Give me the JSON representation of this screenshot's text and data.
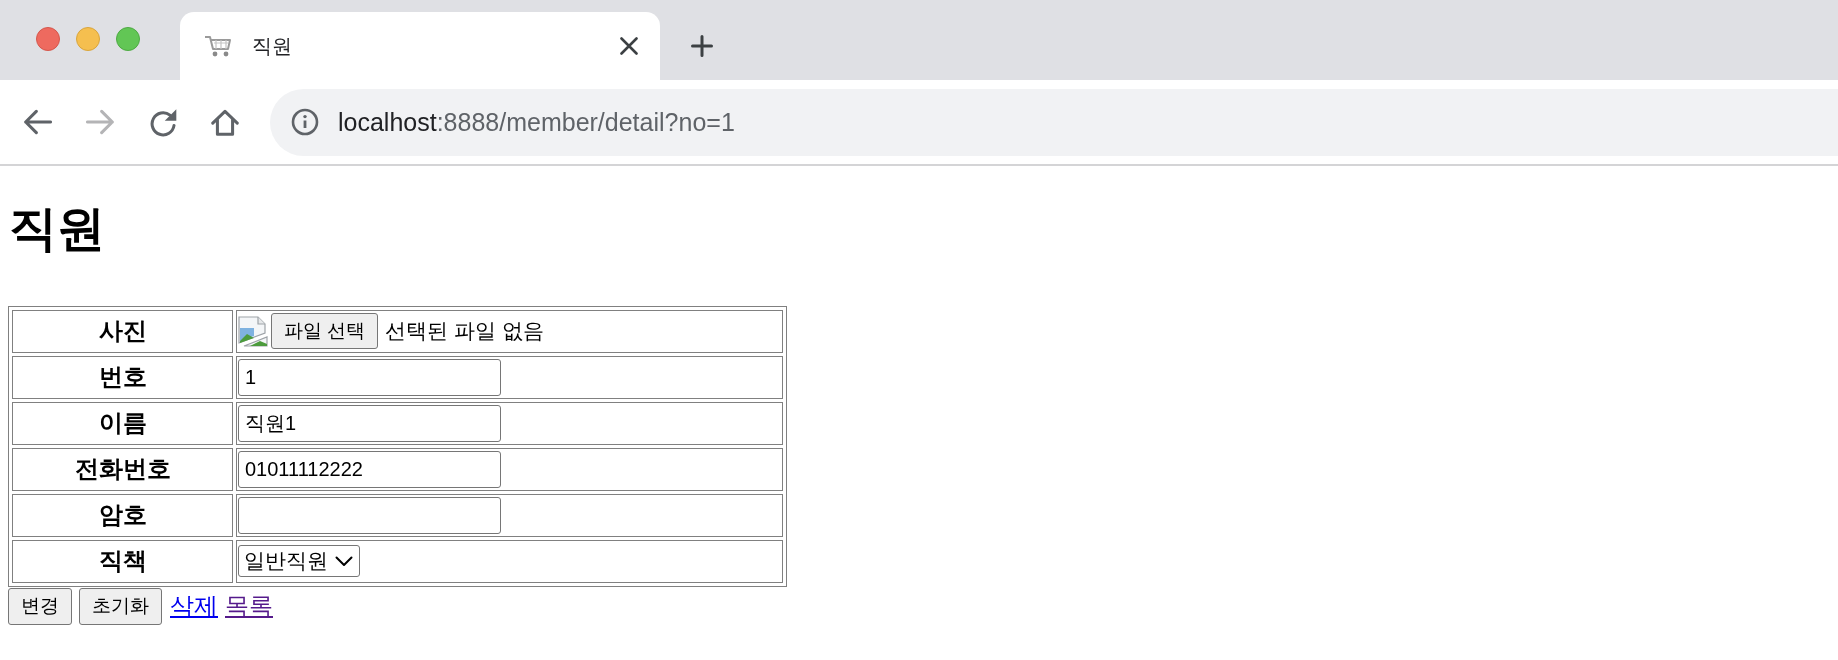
{
  "browser": {
    "tabs": [
      {
        "title": "직원",
        "selected": true
      }
    ],
    "nav_buttons": [
      {
        "kind": "back",
        "disabled": false
      },
      {
        "kind": "forward",
        "disabled": true
      },
      {
        "kind": "reload",
        "disabled": false
      },
      {
        "kind": "home",
        "disabled": false
      }
    ],
    "address": {
      "host": "localhost",
      "path": ":8888/member/detail?no=1"
    }
  },
  "page": {
    "heading": "직원",
    "form": {
      "rows": [
        {
          "label": "사진",
          "kind": "file",
          "button": "파일 선택",
          "status": "선택된 파일 없음"
        },
        {
          "label": "번호",
          "kind": "text",
          "value": "1"
        },
        {
          "label": "이름",
          "kind": "text",
          "value": "직원1"
        },
        {
          "label": "전화번호",
          "kind": "text",
          "value": "01011112222"
        },
        {
          "label": "암호",
          "kind": "password"
        },
        {
          "label": "직책",
          "kind": "select",
          "value": "일반직원"
        }
      ]
    },
    "buttons": [
      {
        "label": "변경"
      },
      {
        "label": "초기화"
      }
    ],
    "links": [
      {
        "label": "삭제",
        "visited": false
      },
      {
        "label": "목록",
        "visited": true
      }
    ]
  }
}
